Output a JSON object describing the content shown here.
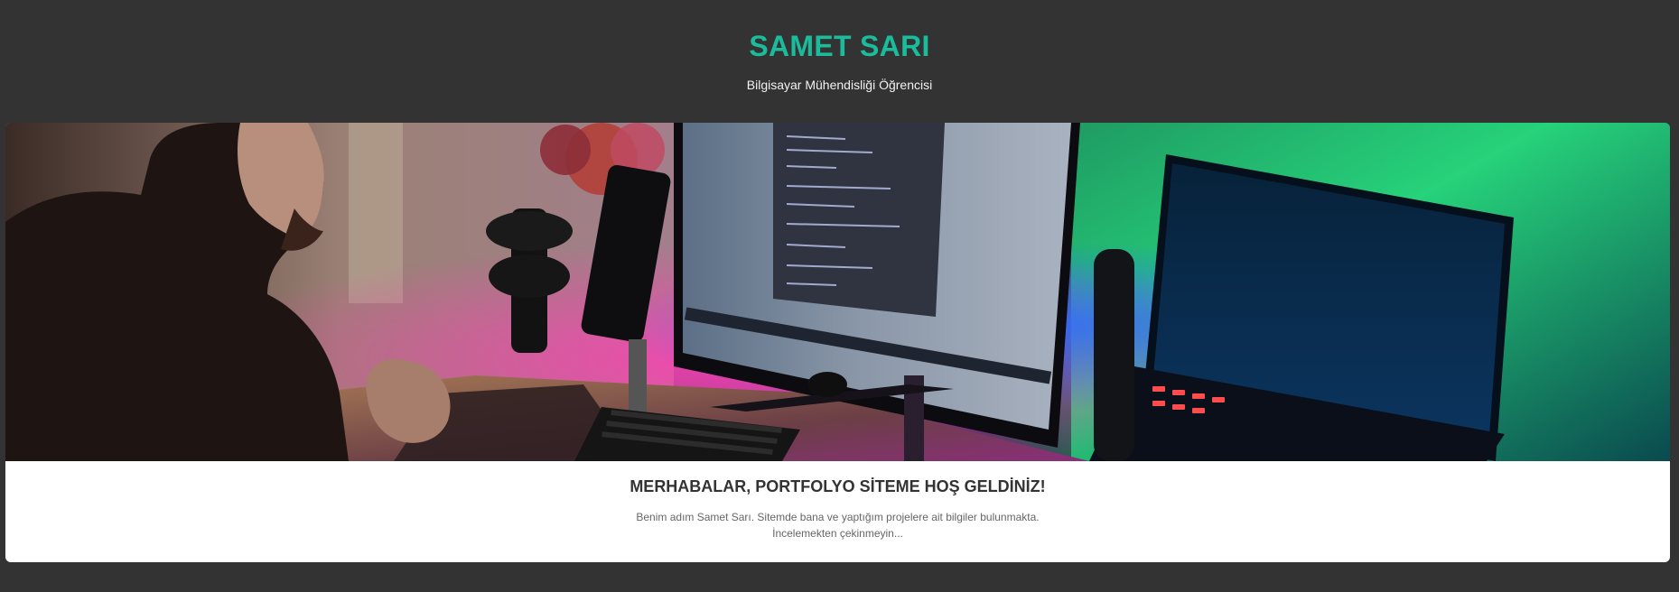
{
  "header": {
    "title": "SAMET SARI",
    "subtitle": "Bilgisayar Mühendisliği Öğrencisi"
  },
  "hero": {
    "image_alt": "Masa başında bilgisayar kurulumu"
  },
  "content": {
    "heading": "MERHABALAR, PORTFOLYO SİTEME HOŞ GELDİNİZ!",
    "intro": "Benim adım Samet Sarı. Sitemde bana ve yaptığım projelere ait bilgiler bulunmakta. İncelemekten çekinmeyin..."
  },
  "colors": {
    "background": "#333333",
    "accent": "#1abc9c",
    "card": "#ffffff",
    "heading": "#333333",
    "body_text": "#666666"
  }
}
